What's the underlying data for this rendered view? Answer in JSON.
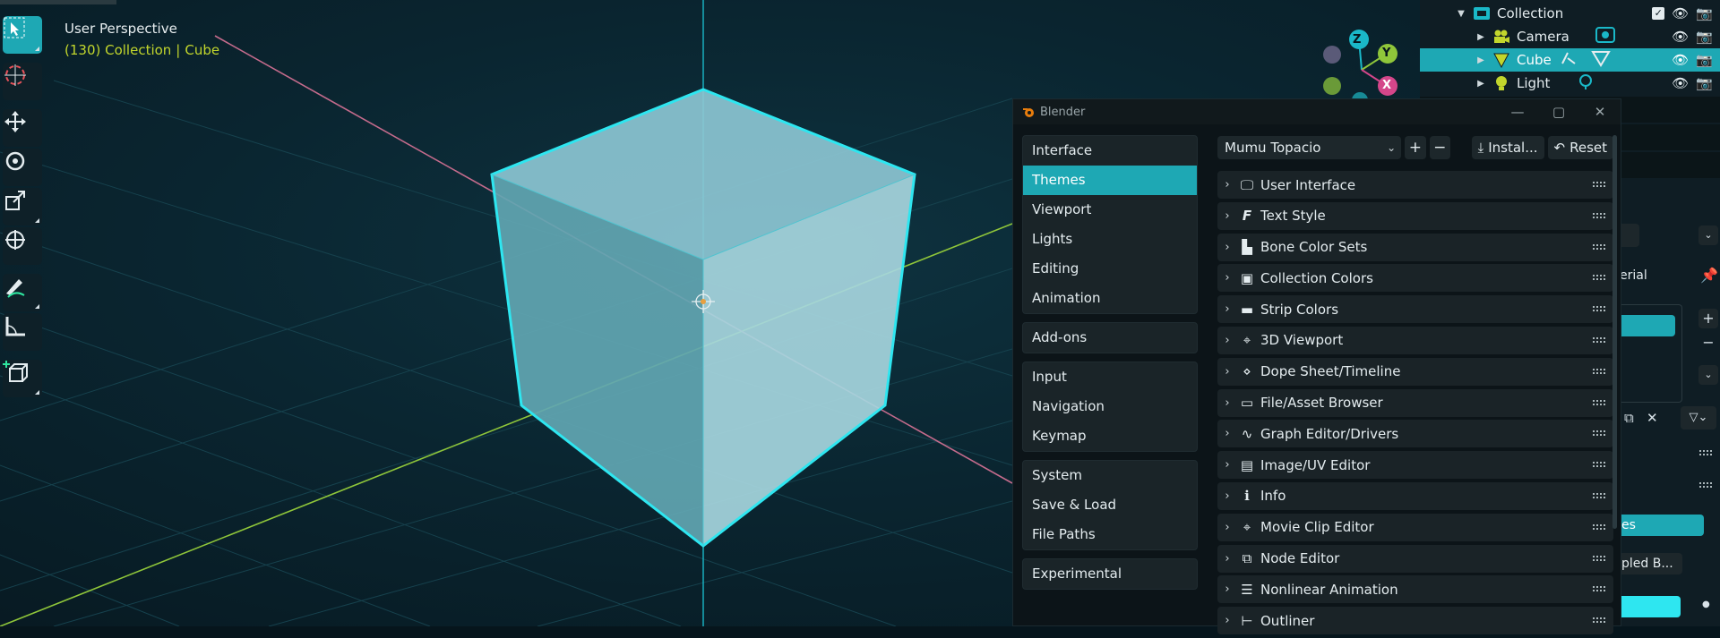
{
  "viewport": {
    "header_line1": "User Perspective",
    "header_frame": "(130) Collection",
    "header_object": "Cube",
    "colors": {
      "x_axis": "#c46b8c",
      "y_axis": "#8fc63a",
      "z_axis": "#1ab8c8",
      "cube_edge": "#2ee6f0",
      "accent": "#1ea8b4"
    }
  },
  "toolbar": {
    "tools": [
      "select-box",
      "cursor",
      "move",
      "rotate",
      "scale",
      "transform",
      "annotate",
      "measure",
      "add-cube"
    ]
  },
  "gizmo": {
    "z": "Z",
    "y": "Y",
    "x": "X"
  },
  "outliner": {
    "rows": [
      {
        "name": "Collection"
      },
      {
        "name": "Camera"
      },
      {
        "name": "Cube"
      },
      {
        "name": "Light"
      }
    ]
  },
  "side_panel": {
    "erial": "erial",
    "pled": "pled B...",
    "es": "es"
  },
  "preferences": {
    "window_title": "Blender",
    "nav_groups": [
      [
        "Interface",
        "Themes",
        "Viewport",
        "Lights",
        "Editing",
        "Animation"
      ],
      [
        "Add-ons"
      ],
      [
        "Input",
        "Navigation",
        "Keymap"
      ],
      [
        "System",
        "Save & Load",
        "File Paths"
      ],
      [
        "Experimental"
      ]
    ],
    "active_nav": "Themes",
    "preset": "Mumu Topacio",
    "install_label": "Instal...",
    "reset_label": "Reset",
    "panels": [
      "User Interface",
      "Text Style",
      "Bone Color Sets",
      "Collection Colors",
      "Strip Colors",
      "3D Viewport",
      "Dope Sheet/Timeline",
      "File/Asset Browser",
      "Graph Editor/Drivers",
      "Image/UV Editor",
      "Info",
      "Movie Clip Editor",
      "Node Editor",
      "Nonlinear Animation",
      "Outliner"
    ]
  }
}
